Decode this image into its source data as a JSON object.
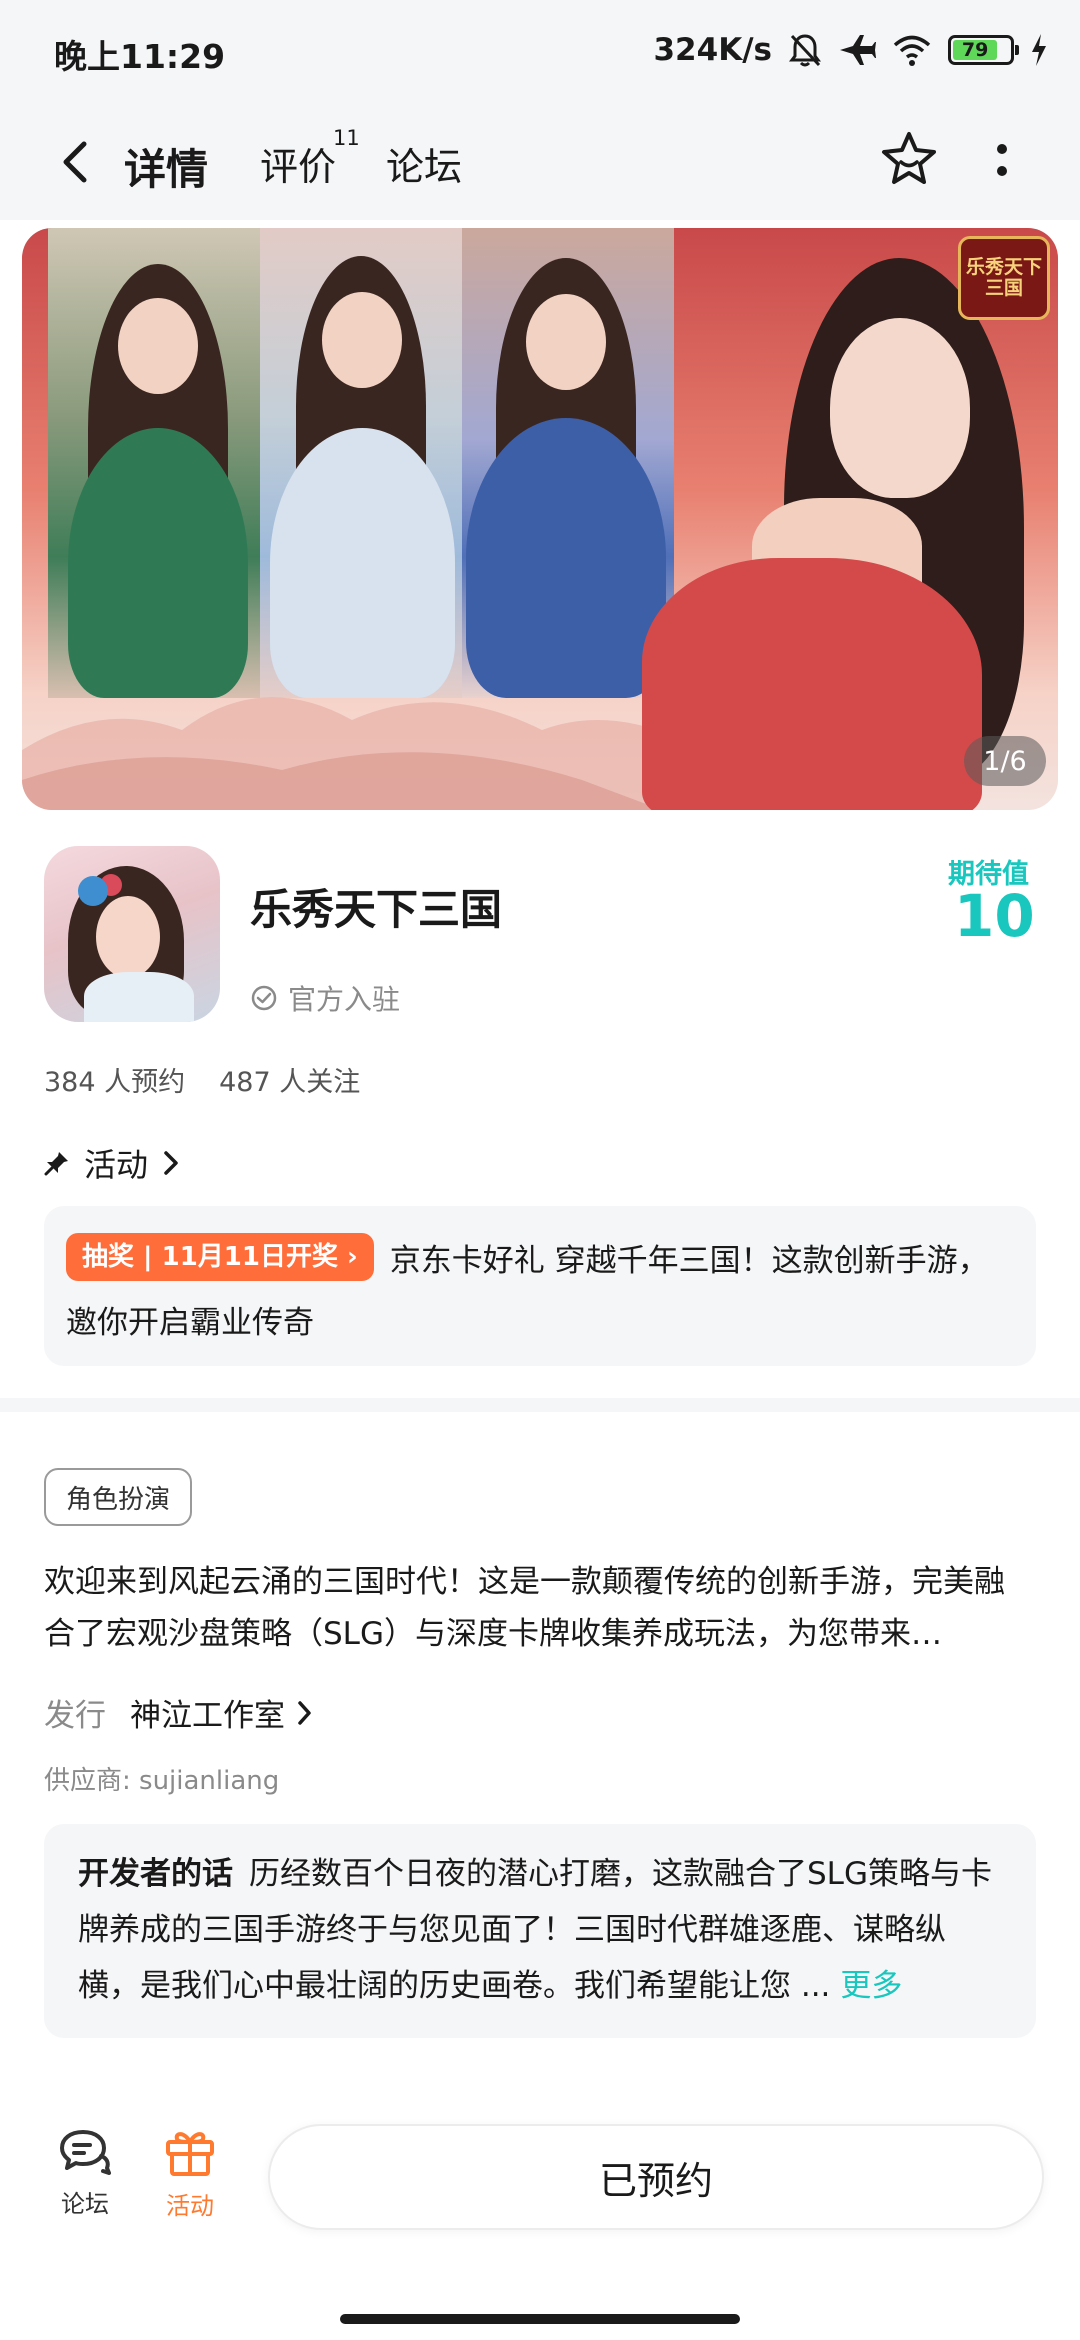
{
  "status_bar": {
    "time": "晚上11:29",
    "network_speed": "324K/s",
    "battery": "79"
  },
  "nav": {
    "tabs": [
      {
        "label": "详情",
        "active": true
      },
      {
        "label": "评价"
      },
      {
        "label": "论坛"
      }
    ],
    "review_count": "11",
    "icons": [
      "back-arrow-icon",
      "star-favorite-icon",
      "more-vertical-icon"
    ]
  },
  "banner": {
    "page_indicator": "1/6",
    "logo_text": "乐秀天下\n三国"
  },
  "game": {
    "title": "乐秀天下三国",
    "official_label": "官方入驻",
    "expectation_label": "期待值",
    "expectation_value": "10",
    "reservations": "384 人预约",
    "followers": "487 人关注"
  },
  "activity": {
    "heading": "活动",
    "badge": "抽奖 | 11月11日开奖 ›",
    "text": "京东卡好礼 穿越千年三国！这款创新手游，邀你开启霸业传奇"
  },
  "details": {
    "genre_tag": "角色扮演",
    "description": "欢迎来到风起云涌的三国时代！这是一款颠覆传统的创新手游，完美融合了宏观沙盘策略（SLG）与深度卡牌收集养成玩法，为您带来…",
    "publisher_label": "发行",
    "publisher_name": "神泣工作室",
    "supplier": "供应商: sujianliang"
  },
  "developer_note": {
    "label": "开发者的话",
    "text": "历经数百个日夜的潜心打磨，这款融合了SLG策略与卡牌养成的三国手游终于与您见面了！三国时代群雄逐鹿、谋略纵横，是我们心中最壮阔的历史画卷。我们希望能让您 ...",
    "more": "更多"
  },
  "bottom_bar": {
    "forum_label": "论坛",
    "activity_label": "活动",
    "reserve_button": "已预约"
  },
  "colors": {
    "accent": "#19c7be",
    "orange": "#ff6e3a",
    "background": "#f5f6f8"
  }
}
